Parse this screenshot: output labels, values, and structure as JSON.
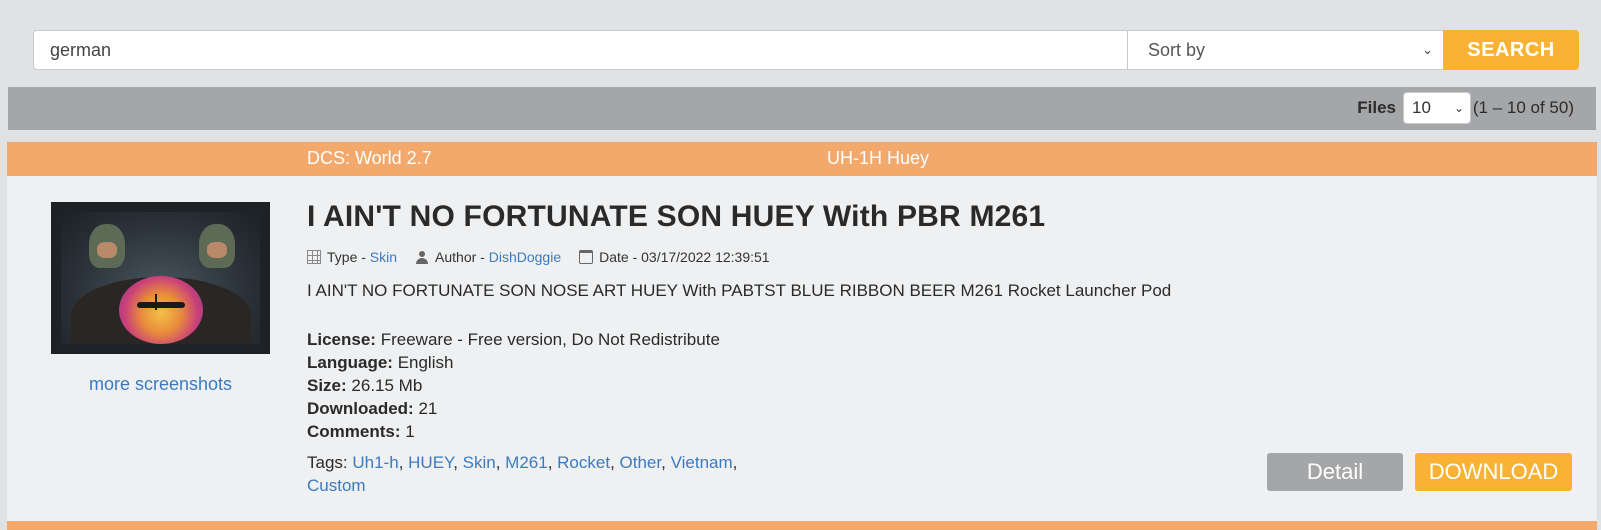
{
  "search": {
    "query": "german",
    "sort_placeholder": "Sort by",
    "button_label": "SEARCH"
  },
  "files_bar": {
    "label": "Files",
    "per_page": "10",
    "range": "(1 – 10 of 50)"
  },
  "result": {
    "game": "DCS: World 2.7",
    "aircraft": "UH-1H Huey",
    "title": "I AIN'T NO FORTUNATE SON HUEY With PBR M261",
    "more_screenshots": "more screenshots",
    "meta": {
      "type_label": "Type - ",
      "type_value": "Skin",
      "author_label": "Author - ",
      "author_value": "DishDoggie",
      "date_label": "Date - ",
      "date_value": "03/17/2022 12:39:51"
    },
    "description": "I AIN'T NO FORTUNATE SON NOSE ART HUEY With PABTST BLUE RIBBON BEER M261 Rocket Launcher Pod",
    "details": {
      "license_label": "License:",
      "license_value": "Freeware - Free version, Do Not Redistribute",
      "language_label": "Language:",
      "language_value": "English",
      "size_label": "Size:",
      "size_value": "26.15 Mb",
      "downloaded_label": "Downloaded:",
      "downloaded_value": "21",
      "comments_label": "Comments:",
      "comments_value": "1"
    },
    "tags_label": "Tags:",
    "tags": [
      "Uh1-h",
      "HUEY",
      "Skin",
      "M261",
      "Rocket",
      "Other",
      "Vietnam",
      "Custom"
    ],
    "detail_button": "Detail",
    "download_button": "DOWNLOAD"
  },
  "colors": {
    "accent_orange": "#f2a96b",
    "button_yellow": "#f9b234",
    "link_blue": "#3c7bbf",
    "bar_gray": "#a5a6a8"
  },
  "icons": [
    "grid-icon",
    "user-icon",
    "calendar-icon",
    "chevron-down-icon"
  ]
}
